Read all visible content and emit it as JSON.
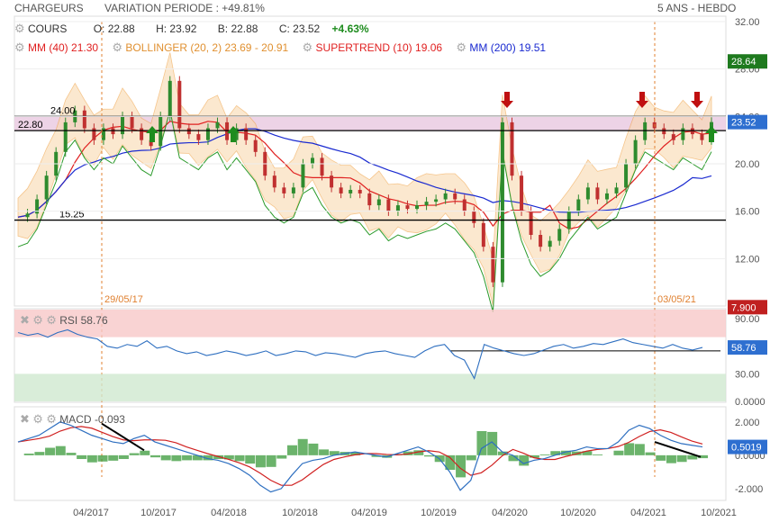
{
  "header": {
    "instrument": "CHARGEURS",
    "variation_label": "VARIATION PERIODE : +49.81%",
    "period": "5 ANS - HEBDO"
  },
  "legend": {
    "cours": "COURS",
    "open": "O: 22.88",
    "high": "H: 23.92",
    "low": "B: 22.88",
    "close": "C: 23.52",
    "change": "+4.63%",
    "mm40": "MM (40)",
    "mm40_val": "21.30",
    "bollinger": "BOLLINGER (20, 2)",
    "bollinger_val": "23.69 - 20.91",
    "supertrend": "SUPERTREND (10)",
    "supertrend_val": "19.06",
    "mm200": "MM (200)",
    "mm200_val": "19.51"
  },
  "colors": {
    "mm40": "#e02020",
    "bollinger": "#f0a040",
    "supertrend": "#2a9a2a",
    "mm200": "#1a2ad0",
    "up": "#2e8b2e",
    "down": "#c03030",
    "rsi": "#2e6fc0",
    "macd": "#2e6fc0",
    "signal": "#d02020"
  },
  "chart_data": [
    {
      "type": "candlestick",
      "title": "CHARGEURS",
      "x_ticks": [
        "04/2017",
        "10/2017",
        "04/2018",
        "10/2018",
        "04/2019",
        "10/2019",
        "04/2020",
        "10/2020",
        "04/2021",
        "10/2021"
      ],
      "y_ticks": [
        "32.00",
        "28.00",
        "24.00",
        "20.00",
        "16.00",
        "12.00"
      ],
      "ylim": [
        8,
        32
      ],
      "horizontal_levels": [
        {
          "label": "24.00",
          "value": 24.0
        },
        {
          "label": "22.80",
          "value": 22.8
        },
        {
          "label": "15.25",
          "value": 15.25
        }
      ],
      "value_badges": [
        {
          "label": "28.64",
          "value": 28.64,
          "color": "#1e7a1e"
        },
        {
          "label": "23.52",
          "value": 23.52,
          "color": "#2e6fd0"
        },
        {
          "label": "7.900",
          "value": 7.9,
          "color": "#c02020"
        }
      ],
      "annotations": [
        {
          "label": "29/05/17",
          "x": "2017-05"
        },
        {
          "label": "03/05/21",
          "x": "2021-05"
        }
      ],
      "series": [
        {
          "name": "MM (40)",
          "last": 21.3
        },
        {
          "name": "BOLLINGER (20, 2)",
          "upper": 23.69,
          "lower": 20.91
        },
        {
          "name": "SUPERTREND (10)",
          "last": 19.06
        },
        {
          "name": "MM (200)",
          "last": 19.51
        }
      ],
      "price_path": [
        15.5,
        15.8,
        17,
        19,
        21,
        23.5,
        24.5,
        23,
        22,
        23,
        22.5,
        24,
        23,
        22,
        21.5,
        24,
        27,
        23,
        22.5,
        22,
        23,
        23.5,
        22,
        23,
        22,
        21,
        19,
        18,
        17.5,
        18,
        20,
        20.5,
        19,
        18,
        17.5,
        17.8,
        17.5,
        16.5,
        17,
        16,
        16.5,
        16.2,
        16.5,
        16.8,
        17,
        17.5,
        17,
        16,
        15,
        13,
        10,
        23.5,
        19,
        16,
        14,
        13,
        13.5,
        14.5,
        16,
        17,
        18,
        17,
        17.5,
        18,
        20,
        22,
        23.5,
        23,
        22.5,
        22,
        23,
        22.5,
        22,
        23.52
      ]
    },
    {
      "type": "line",
      "title": "RSI",
      "label": "RSI",
      "last": "58.76",
      "y_ticks": [
        "90.00",
        "60.00",
        "30.00",
        "0.0000"
      ],
      "ylim": [
        0,
        100
      ],
      "zones": [
        70,
        30
      ],
      "path": [
        75,
        72,
        74,
        70,
        75,
        78,
        73,
        70,
        68,
        60,
        58,
        62,
        60,
        66,
        58,
        60,
        55,
        52,
        54,
        50,
        52,
        55,
        53,
        50,
        52,
        55,
        50,
        52,
        55,
        54,
        50,
        53,
        52,
        50,
        48,
        52,
        54,
        55,
        52,
        50,
        48,
        55,
        60,
        62,
        50,
        45,
        25,
        62,
        58,
        55,
        52,
        50,
        52,
        56,
        60,
        62,
        58,
        60,
        63,
        62,
        65,
        68,
        64,
        62,
        60,
        58,
        62,
        58,
        56,
        58.76
      ]
    },
    {
      "type": "line",
      "title": "MACD",
      "label": "MACD",
      "last_label": "-0.093",
      "last_badge": "0.5019",
      "y_ticks": [
        "2.000",
        "0.0000",
        "-2.000"
      ],
      "ylim": [
        -2.6,
        2.8
      ],
      "macd_path": [
        0.8,
        1.0,
        1.2,
        1.6,
        2.0,
        1.8,
        1.5,
        1.2,
        1.0,
        0.8,
        0.7,
        1.0,
        1.2,
        0.8,
        0.6,
        0.4,
        0.2,
        0.0,
        -0.2,
        -0.3,
        -0.5,
        -0.8,
        -1.2,
        -1.8,
        -2.2,
        -2.0,
        -1.2,
        -0.5,
        -0.3,
        -0.2,
        0,
        0.1,
        0.2,
        0.1,
        0,
        -0.1,
        0.1,
        0.3,
        0.5,
        0.2,
        -0.2,
        -1.0,
        -2.1,
        -1.5,
        0.4,
        0.8,
        0.2,
        0.0,
        -0.5,
        -0.3,
        -0.2,
        0.0,
        0.2,
        0.3,
        0.5,
        0.4,
        0.4,
        0.8,
        1.5,
        1.8,
        1.6,
        1.2,
        0.9,
        0.7,
        0.6,
        0.5
      ]
    }
  ]
}
